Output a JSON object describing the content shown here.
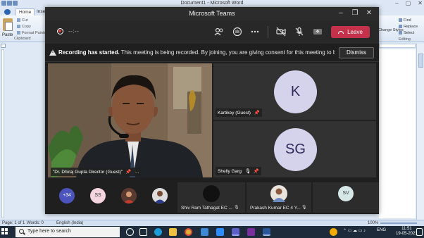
{
  "word": {
    "title": "Document1 - Microsoft Word",
    "tabs": [
      "Home",
      "Insert"
    ],
    "clipboard": {
      "paste": "Paste",
      "cut": "Cut",
      "copy": "Copy",
      "format_painter": "Format Painter",
      "group": "Clipboard"
    },
    "editing": {
      "find": "Find",
      "replace": "Replace",
      "select": "Select",
      "group": "Editing"
    },
    "styles": "Change Styles",
    "status": {
      "page": "Page: 1 of 1",
      "words": "Words: 0",
      "language": "English (India)",
      "zoom": "100%"
    }
  },
  "teams": {
    "title": "Microsoft Teams",
    "timer": "--:--",
    "leave_label": "Leave",
    "banner": {
      "bold": "Recording has started.",
      "text": "This meeting is being recorded. By joining, you are giving consent for this meeting to be rec...",
      "dismiss": "Dismiss"
    },
    "main_speaker": "\"Dr. Dhiraj Gupta Director (Guest)\"",
    "main_more": "...",
    "tiles": [
      {
        "initials": "K",
        "name": "Kartikey (Guest)"
      },
      {
        "initials": "SG",
        "name": "Shelly Garg"
      }
    ],
    "strip": {
      "overflow": "+34",
      "ss": "SS",
      "sv": "SV",
      "tile1_name": "Shiv Ram Tathagat EC ...",
      "tile2_name": "Prakash Kumar EC 4 Y..."
    }
  },
  "taskbar": {
    "search_placeholder": "Type here to search",
    "lang": "ENG",
    "time": "11:51",
    "date": "19-05-2021"
  },
  "colors": {
    "leave": "#c4314b",
    "avatar": "#d5d3eb",
    "overflow_chip": "#4b53bc"
  }
}
